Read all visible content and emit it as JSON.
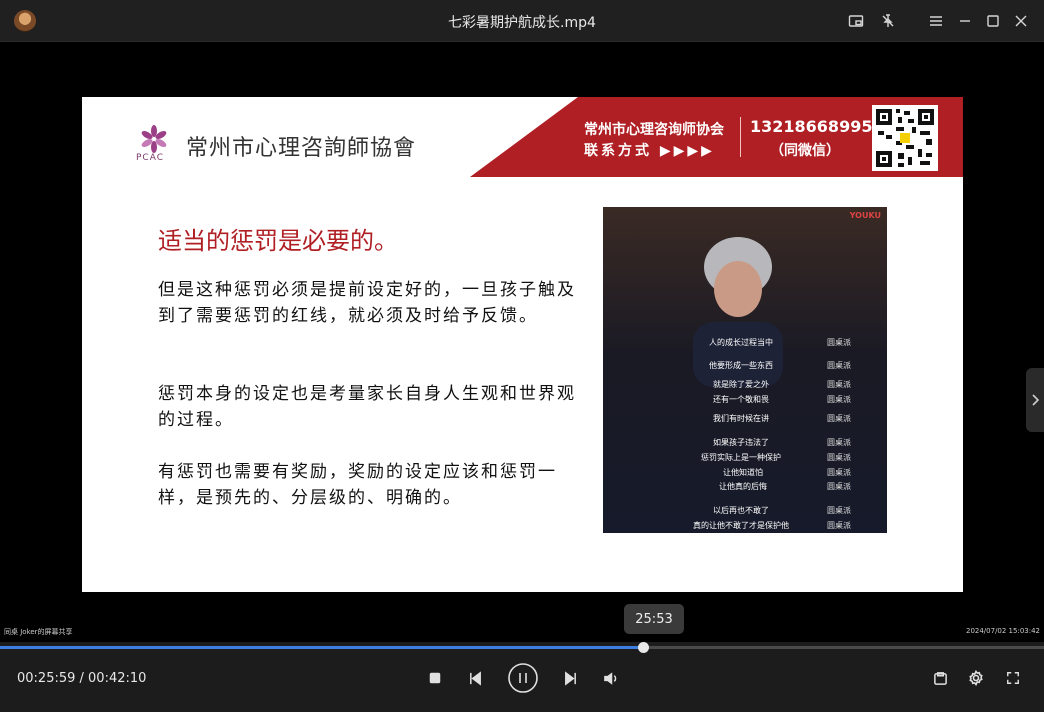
{
  "window": {
    "title": "七彩暑期护航成长.mp4"
  },
  "slide": {
    "org_logo_text": "PCAC",
    "org_name": "常州市心理咨詢師協會",
    "banner": {
      "line1": "常州市心理咨询师协会",
      "line2": "联系方式 ▶▶▶▶",
      "phone": "13218668995",
      "wechat": "（同微信）"
    },
    "heading": "适当的惩罚是必要的。",
    "paragraphs": [
      "但是这种惩罚必须是提前设定好的，一旦孩子触及到了需要惩罚的红线，就必须及时给予反馈。",
      "惩罚本身的设定也是考量家长自身人生观和世界观的过程。",
      "有惩罚也需要有奖励，奖励的设定应该和惩罚一样，是预先的、分层级的、明确的。"
    ],
    "embedded_video": {
      "watermark": "YOUKU",
      "subtitles": [
        {
          "text": "人的成长过程当中",
          "name": "圆桌派"
        },
        {
          "text": "他要形成一些东西",
          "name": "圆桌派"
        },
        {
          "text": "就是除了爱之外",
          "name": "圆桌派"
        },
        {
          "text": "还有一个敬和畏",
          "name": "圆桌派"
        },
        {
          "text": "我们有时候在讲",
          "name": "圆桌派"
        },
        {
          "text": "如果孩子违法了",
          "name": "圆桌派"
        },
        {
          "text": "惩罚实际上是一种保护",
          "name": "圆桌派"
        },
        {
          "text": "让他知道怕",
          "name": "圆桌派"
        },
        {
          "text": "让他真的后悔",
          "name": "圆桌派"
        },
        {
          "text": "以后再也不敢了",
          "name": "圆桌派"
        },
        {
          "text": "真的让他不敢了才是保护他",
          "name": "圆桌派"
        }
      ]
    }
  },
  "osd": {
    "left": "同桌 Joker的屏幕共享",
    "right": "2024/07/02 15:03:42"
  },
  "player": {
    "hover_time": "25:53",
    "time_display": "00:25:59 / 00:42:10",
    "progress": 0.616
  }
}
